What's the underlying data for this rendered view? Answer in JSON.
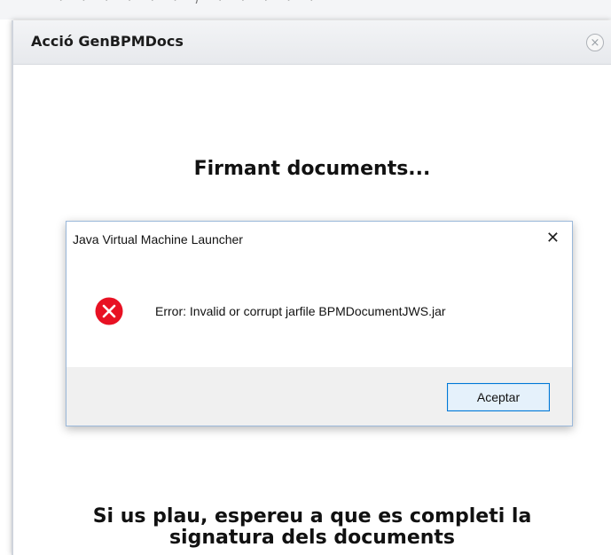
{
  "background": {
    "cropped_text": "· · · · · · / · · · · ·"
  },
  "app_dialog": {
    "title": "Acció GenBPMDocs",
    "close_glyph": "×",
    "heading": "Firmant documents...",
    "message_line1": "Si us plau, espereu a que es completi la",
    "message_line2": "signatura dels documents"
  },
  "jvm_dialog": {
    "title": "Java Virtual Machine Launcher",
    "close_glyph": "✕",
    "icon": "error-icon",
    "error_color": "#e81123",
    "message": "Error: Invalid or corrupt jarfile BPMDocumentJWS.jar",
    "ok_button": "Aceptar"
  }
}
